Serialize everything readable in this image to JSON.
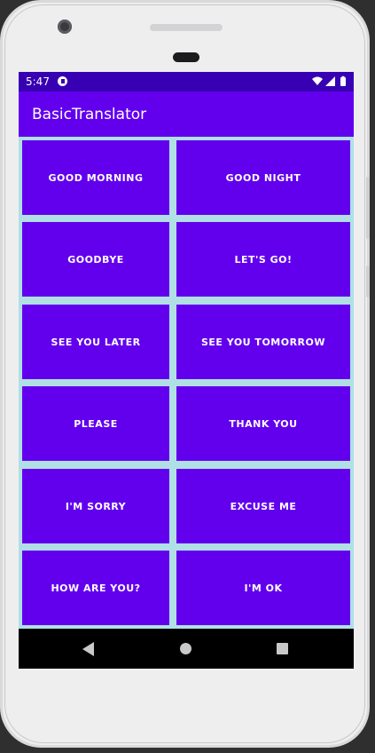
{
  "status_bar": {
    "time": "5:47",
    "icons": [
      "notification-app-icon",
      "wifi-icon",
      "cellular-signal-icon",
      "battery-icon"
    ]
  },
  "app_bar": {
    "title": "BasicTranslator"
  },
  "phrases": [
    "GOOD MORNING",
    "GOOD NIGHT",
    "GOODBYE",
    "LET'S GO!",
    "SEE YOU LATER",
    "SEE YOU TOMORROW",
    "PLEASE",
    "THANK YOU",
    "I'M SORRY",
    "EXCUSE ME",
    "HOW ARE YOU?",
    "I'M OK"
  ],
  "nav_bar": {
    "icons": [
      "back-icon",
      "home-icon",
      "recents-icon"
    ]
  },
  "colors": {
    "status_bar": "#3700b3",
    "app_bar": "#6200ee",
    "button": "#6200ee",
    "grid_background": "#b0e0e6",
    "nav_bar": "#000000"
  }
}
